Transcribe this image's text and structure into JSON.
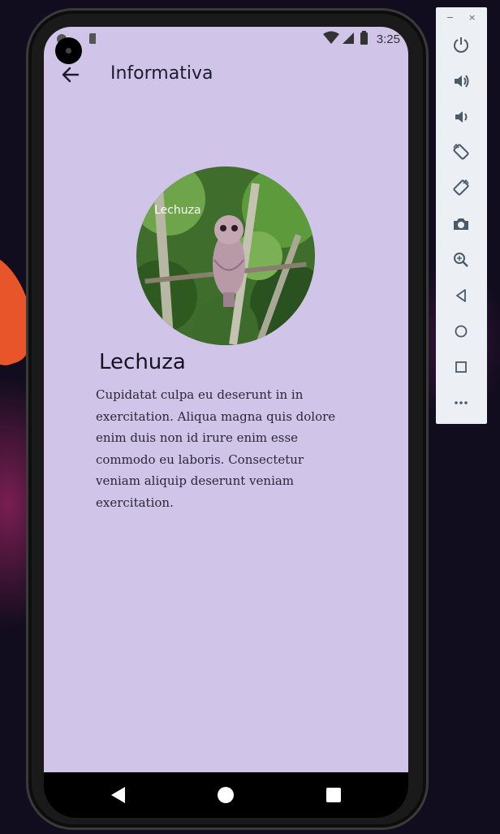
{
  "status_bar": {
    "time": "3:25"
  },
  "app_bar": {
    "title": "Informativa"
  },
  "image": {
    "caption": "Lechuza"
  },
  "content": {
    "heading": "Lechuza",
    "body": "Cupidatat culpa eu deserunt in in exercitation. Aliqua magna quis dolore enim duis non id irure enim esse commodo eu laboris. Consectetur veniam aliquip deserunt veniam exercitation."
  },
  "colors": {
    "screen_background": "#d0c5e8",
    "text_primary": "#15121f",
    "nav_bar": "#000000",
    "panel_background": "#eceff3",
    "panel_icon": "#4a5a6a"
  },
  "emulator_controls": [
    {
      "name": "power-icon"
    },
    {
      "name": "volume-up-icon"
    },
    {
      "name": "volume-down-icon"
    },
    {
      "name": "rotate-left-icon"
    },
    {
      "name": "rotate-right-icon"
    },
    {
      "name": "camera-icon"
    },
    {
      "name": "zoom-icon"
    },
    {
      "name": "back-icon"
    },
    {
      "name": "home-icon"
    },
    {
      "name": "overview-icon"
    },
    {
      "name": "more-icon"
    }
  ],
  "window_controls": {
    "minimize": "−",
    "close": "×"
  }
}
